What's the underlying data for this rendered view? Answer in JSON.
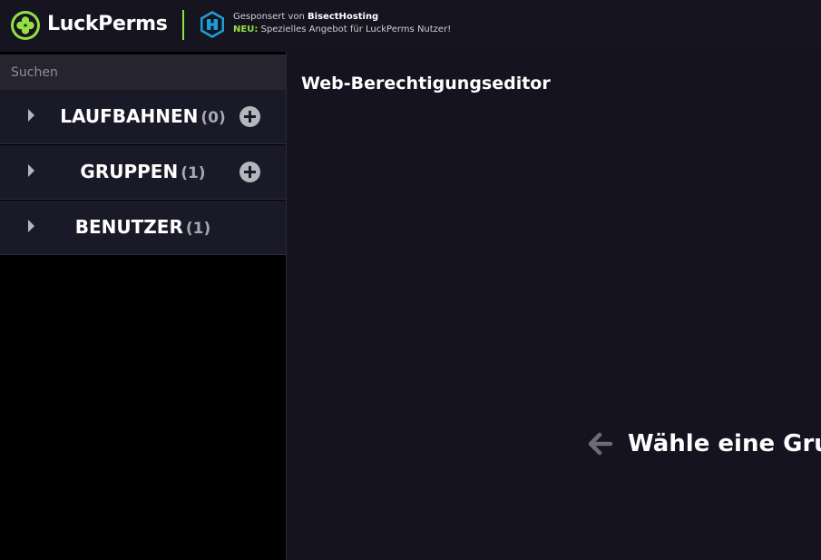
{
  "header": {
    "app_name": "LuckPerms",
    "logo_icon": "clover-icon",
    "sponsor": {
      "prefix": "Gesponsert von ",
      "name": "BisectHosting",
      "badge": "NEU:",
      "offer": " Spezielles Angebot für LuckPerms Nutzer!",
      "icon": "bisecthosting-icon"
    },
    "accent_color": "#94e044"
  },
  "sidebar": {
    "search_placeholder": "Suchen",
    "items": [
      {
        "label": "LAUFBAHNEN",
        "count": "(0)",
        "has_add": true
      },
      {
        "label": "GRUPPEN",
        "count": "(1)",
        "has_add": true
      },
      {
        "label": "BENUTZER",
        "count": "(1)",
        "has_add": false
      }
    ]
  },
  "main": {
    "title": "Web-Berechtigungseditor",
    "hint": "Wähle eine Gruppe oder einen Benutzer"
  }
}
